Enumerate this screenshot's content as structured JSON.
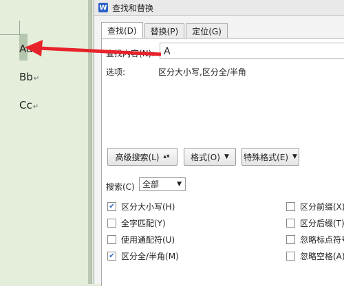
{
  "document": {
    "lines": [
      {
        "text": "Aa"
      },
      {
        "text": "Bb"
      },
      {
        "text": "Cc"
      }
    ],
    "paragraph_mark": "↵"
  },
  "dialog": {
    "app_icon": "W",
    "title": "查找和替换",
    "tabs": [
      {
        "label": "查找(D)"
      },
      {
        "label": "替换(P)"
      },
      {
        "label": "定位(G)"
      }
    ],
    "find_label": "查找内容(N):",
    "find_value": "A",
    "options_label": "选项:",
    "options_value": "区分大小写,区分全/半角",
    "buttons": {
      "advanced": "高级搜索(L)",
      "format": "格式(O)",
      "special": "特殊格式(E)"
    },
    "search_label": "搜索(C)",
    "search_scope": "全部",
    "checkboxes_left": [
      {
        "label": "区分大小写(H)",
        "checked": true
      },
      {
        "label": "全字匹配(Y)",
        "checked": false
      },
      {
        "label": "使用通配符(U)",
        "checked": false
      },
      {
        "label": "区分全/半角(M)",
        "checked": true
      }
    ],
    "checkboxes_right": [
      {
        "label": "区分前缀(X)",
        "checked": false
      },
      {
        "label": "区分后缀(T)",
        "checked": false
      },
      {
        "label": "忽略标点符号",
        "checked": false
      },
      {
        "label": "忽略空格(A)",
        "checked": false
      }
    ]
  },
  "colors": {
    "annotation_arrow": "#e8222a",
    "doc_background": "#e4eedb"
  }
}
